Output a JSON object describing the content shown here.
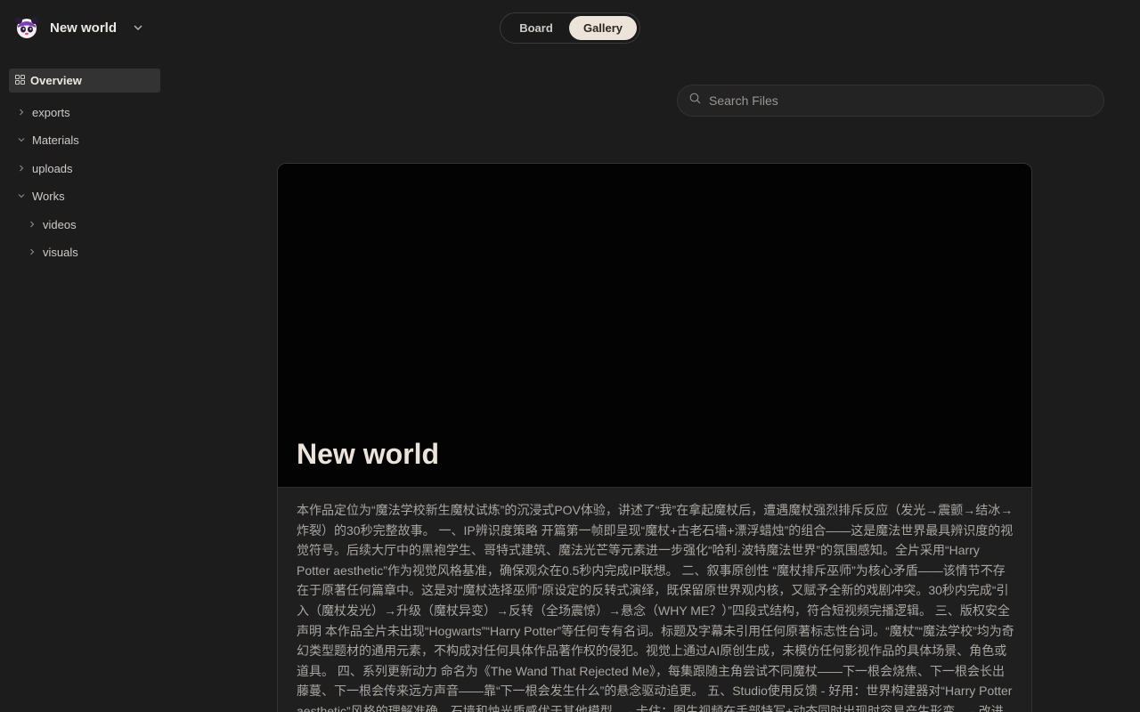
{
  "workspace": {
    "name": "New world",
    "avatar_icon": "panda-avatar-icon"
  },
  "sidebar": {
    "overview_label": "Overview",
    "items": [
      {
        "label": "exports",
        "expanded": false,
        "depth": 0
      },
      {
        "label": "Materials",
        "expanded": true,
        "depth": 0
      },
      {
        "label": "uploads",
        "expanded": false,
        "depth": 0
      },
      {
        "label": "Works",
        "expanded": true,
        "depth": 0
      },
      {
        "label": "videos",
        "expanded": false,
        "depth": 1
      },
      {
        "label": "visuals",
        "expanded": false,
        "depth": 1
      }
    ]
  },
  "toggle": {
    "board_label": "Board",
    "gallery_label": "Gallery",
    "active": "Gallery"
  },
  "search": {
    "placeholder": "Search Files",
    "value": ""
  },
  "card": {
    "title": "New world",
    "description": "本作品定位为“魔法学校新生魔杖试炼”的沉浸式POV体验，讲述了“我”在拿起魔杖后，遭遇魔杖强烈排斥反应（发光→震颤→结冰→炸裂）的30秒完整故事。 一、IP辨识度策略 开篇第一帧即呈现“魔杖+古老石墙+漂浮蜡烛”的组合——这是魔法世界最具辨识度的视觉符号。后续大厅中的黑袍学生、哥特式建筑、魔法光芒等元素进一步强化“哈利·波特魔法世界”的氛围感知。全片采用“Harry Potter aesthetic”作为视觉风格基准，确保观众在0.5秒内完成IP联想。 二、叙事原创性 “魔杖排斥巫师”为核心矛盾——该情节不存在于原著任何篇章中。这是对“魔杖选择巫师”原设定的反转式演绎，既保留原世界观内核，又赋予全新的戏剧冲突。30秒内完成“引入（魔杖发光）→升级（魔杖异变）→反转（全场震惊）→悬念（WHY ME？）”四段式结构，符合短视频完播逻辑。 三、版权安全声明 本作品全片未出现“Hogwarts”“Harry Potter”等任何专有名词。标题及字幕未引用任何原著标志性台词。“魔杖”“魔法学校”均为奇幻类型题材的通用元素，不构成对任何具体作品著作权的侵犯。视觉上通过AI原创生成，未模仿任何影视作品的具体场景、角色或道具。 四、系列更新动力 命名为《The Wand That Rejected Me》，每集跟随主角尝试不同魔杖——下一根会烧焦、下一根会长出藤蔓、下一根会传来远方声音——靠“下一根会发生什么”的悬念驱动追更。 五、Studio使用反馈 - 好用：世界构建器对“Harry Potter aesthetic”风格的理解准确，石墙和烛光质感优于其他模型。 - 卡住：图生视频在手部特写+动态同时出现时容易产生形变。 - 改进"
  },
  "colors": {
    "background": "#1c1c1c",
    "accent_gallery": "#ede4d9",
    "hero": "#030303"
  }
}
